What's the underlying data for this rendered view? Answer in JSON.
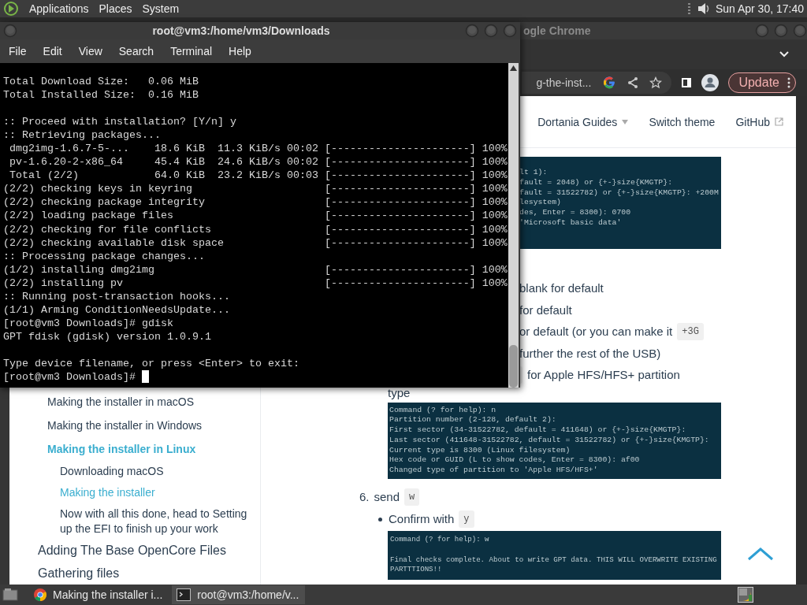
{
  "top_panel": {
    "menus": [
      "Applications",
      "Places",
      "System"
    ],
    "clock": "Sun Apr 30, 17:40"
  },
  "browser": {
    "title": "ogle Chrome",
    "url": "g-the-inst...",
    "update_button": "Update",
    "nav": [
      {
        "label": "Dortania Guides",
        "kind": "dropdown"
      },
      {
        "label": "Switch theme",
        "kind": "link"
      },
      {
        "label": "GitHub",
        "kind": "external"
      }
    ],
    "sidebar": {
      "items": [
        {
          "label": "Making the installer in macOS",
          "selected": false
        },
        {
          "label": "Making the installer in Windows",
          "selected": false
        },
        {
          "label": "Making the installer in Linux",
          "selected": true,
          "children": [
            {
              "label": "Downloading macOS",
              "selected": false
            },
            {
              "label": "Making the installer",
              "selected": true
            },
            {
              "label": "Now with all this done, head to Setting up the EFI to finish up your work",
              "selected": false
            }
          ]
        }
      ],
      "chapters": [
        "Adding The Base OpenCore Files",
        "Gathering files"
      ]
    },
    "content": {
      "code_fragment": [
        "lt 1):",
        "fault = 2048) or {+-}size{KMGTP}:",
        "fault = 31522782) or {+-}size{KMGTP}: +200M",
        "lesystem)",
        "des, Enter = 8300): 0700",
        "'Microsoft basic data'"
      ],
      "fragments": [
        {
          "text": "blank for default",
          "kind": "plain"
        },
        {
          "text": "for default",
          "kind": "plain"
        },
        {
          "text": "or default (or you can make it",
          "kind": "code-after",
          "code": "+3G"
        },
        {
          "text": "further the rest of the USB)",
          "kind": "plain"
        },
        {
          "text": "for Apple HFS/HFS+ partition",
          "kind": "code-before"
        }
      ],
      "type_label": "type",
      "code_block": [
        "Command (? for help): n",
        "Partition number (2-128, default 2):",
        "First sector (34-31522782, default = 411648) or {+-}size{KMGTP}:",
        "Last sector (411648-31522782, default = 31522782) or {+-}size{KMGTP}:",
        "Current type is 8300 (Linux filesystem)",
        "Hex code or GUID (L to show codes, Enter = 8300): af00",
        "Changed type of partition to 'Apple HFS/HFS+'"
      ],
      "step": {
        "number": "6.",
        "text": "send",
        "code": "w",
        "bullets": [
          {
            "text": "Confirm with",
            "code": "y"
          }
        ]
      },
      "final_code_block": [
        [
          "Command (? for help): w"
        ],
        [
          "Final checks complete. About to write GPT data. THIS WILL OVERWRITE EXISTING",
          "PARTTTIONS!!"
        ]
      ]
    }
  },
  "terminal": {
    "title": "root@vm3:/home/vm3/Downloads",
    "menus": [
      "File",
      "Edit",
      "View",
      "Search",
      "Terminal",
      "Help"
    ],
    "blocks": [
      [
        {
          "text": "Total Download Size:   0.06 MiB"
        },
        {
          "text": "Total Installed Size:  0.16 MiB"
        }
      ],
      [
        {
          "text": ":: Proceed with installation? [Y/n] y"
        },
        {
          "text": ":: Retrieving packages..."
        },
        {
          "text": " dmg2img-1.6.7-5-...    18.6 KiB  11.3 KiB/s 00:02",
          "bar": "[----------------------] 100%"
        },
        {
          "text": " pv-1.6.20-2-x86_64     45.4 KiB  24.6 KiB/s 00:02",
          "bar": "[----------------------] 100%"
        },
        {
          "text": " Total (2/2)            64.0 KiB  23.2 KiB/s 00:03",
          "bar": "[----------------------] 100%"
        },
        {
          "text": "(2/2) checking keys in keyring",
          "bar": "[----------------------] 100%"
        },
        {
          "text": "(2/2) checking package integrity",
          "bar": "[----------------------] 100%"
        },
        {
          "text": "(2/2) loading package files",
          "bar": "[----------------------] 100%"
        },
        {
          "text": "(2/2) checking for file conflicts",
          "bar": "[----------------------] 100%"
        },
        {
          "text": "(2/2) checking available disk space",
          "bar": "[----------------------] 100%"
        },
        {
          "text": ":: Processing package changes..."
        },
        {
          "text": "(1/2) installing dmg2img",
          "bar": "[----------------------] 100%"
        },
        {
          "text": "(2/2) installing pv",
          "bar": "[----------------------] 100%"
        },
        {
          "text": ":: Running post-transaction hooks..."
        },
        {
          "text": "(1/1) Arming ConditionNeedsUpdate..."
        },
        {
          "text": "[root@vm3 Downloads]# gdisk"
        },
        {
          "text": "GPT fdisk (gdisk) version 1.0.9.1"
        }
      ],
      [
        {
          "text": "Type device filename, or press <Enter> to exit:"
        },
        {
          "text": "[root@vm3 Downloads]#"
        }
      ]
    ]
  },
  "taskbar": {
    "tasks": [
      {
        "label": "Making the installer i...",
        "kind": "browser",
        "selected": false
      },
      {
        "label": "root@vm3:/home/v...",
        "kind": "terminal",
        "selected": true
      }
    ]
  }
}
